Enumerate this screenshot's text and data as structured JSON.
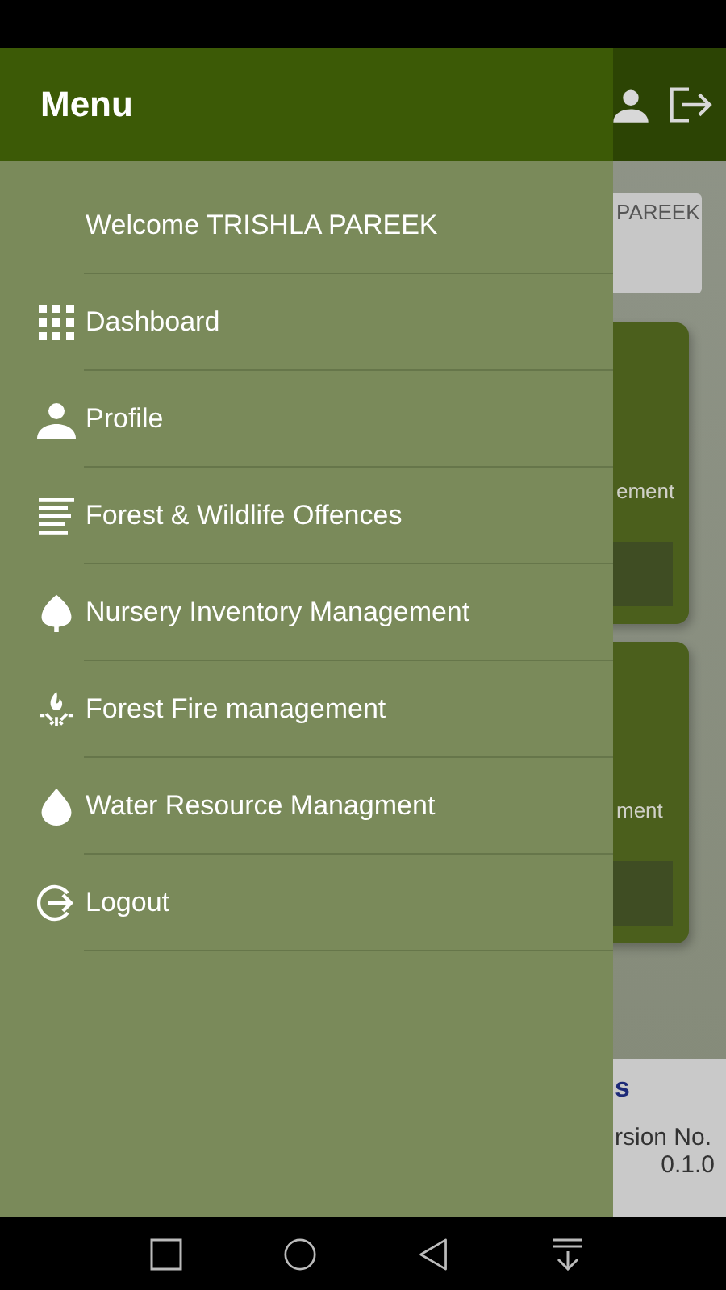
{
  "drawer": {
    "title": "Menu",
    "welcome": "Welcome TRISHLA PAREEK",
    "items": [
      {
        "kind": "grid",
        "label": "Dashboard"
      },
      {
        "kind": "person",
        "label": "Profile"
      },
      {
        "kind": "lines",
        "label": "Forest & Wildlife Offences"
      },
      {
        "kind": "leaf",
        "label": "Nursery Inventory Management"
      },
      {
        "kind": "fire",
        "label": "Forest Fire management"
      },
      {
        "kind": "drop",
        "label": "Water Resource Managment"
      },
      {
        "kind": "logout",
        "label": "Logout"
      }
    ]
  },
  "background": {
    "user_card": "PAREEK",
    "cards": [
      "ement",
      "ment"
    ],
    "footer": {
      "title": "s",
      "version_label": "rsion No.",
      "version": "0.1.0"
    }
  }
}
